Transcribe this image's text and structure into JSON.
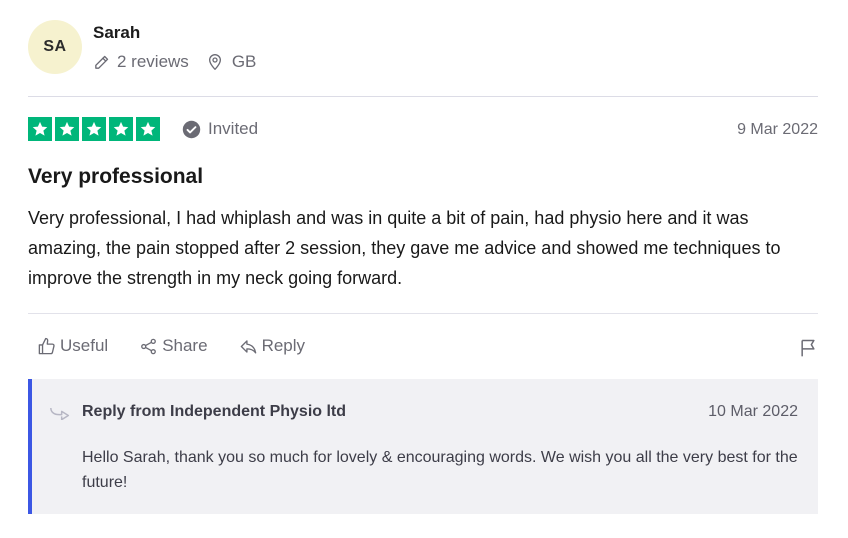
{
  "reviewer": {
    "initials": "SA",
    "name": "Sarah",
    "reviews_count_label": "2 reviews",
    "country": "GB",
    "avatar_color": "#f6f2cf"
  },
  "review": {
    "rating": 5,
    "rating_max": 5,
    "star_color": "#00b67a",
    "invited_label": "Invited",
    "date": "9 Mar 2022",
    "title": "Very professional",
    "body": "Very professional, I had whiplash and was in quite a bit of pain, had physio here and it was amazing, the pain stopped after 2 session, they gave me advice and showed me techniques to improve the strength in my neck going forward."
  },
  "actions": {
    "useful_label": "Useful",
    "share_label": "Share",
    "reply_label": "Reply",
    "flag_icon": "flag-icon"
  },
  "company_reply": {
    "from_label": "Reply from Independent Physio ltd",
    "date": "10 Mar 2022",
    "text": "Hello Sarah, thank you so much for lovely & encouraging words. We wish you all the very best for the future!",
    "accent_color": "#3c57e4"
  }
}
